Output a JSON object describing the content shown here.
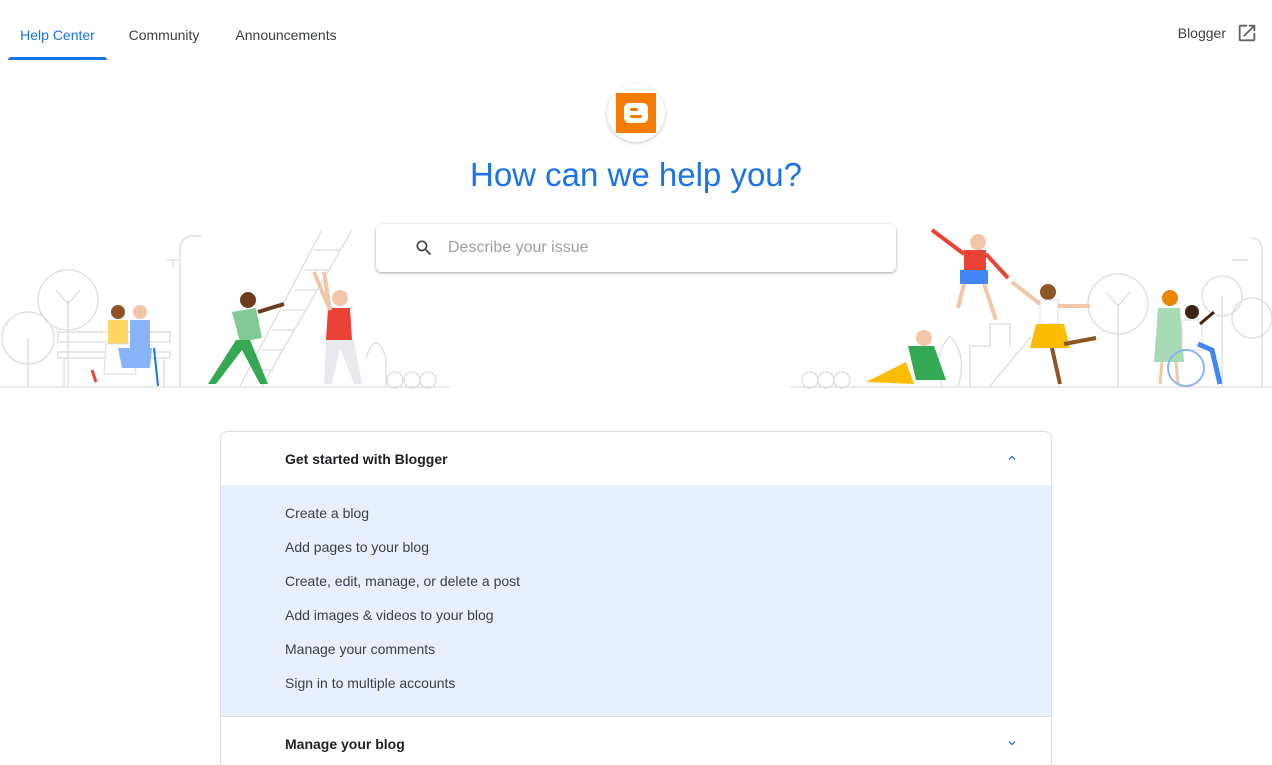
{
  "nav": {
    "tabs": [
      {
        "label": "Help Center",
        "active": true
      },
      {
        "label": "Community",
        "active": false
      },
      {
        "label": "Announcements",
        "active": false
      }
    ],
    "product_link": {
      "label": "Blogger",
      "icon": "open-in-new-icon"
    }
  },
  "hero": {
    "logo": "blogger-logo",
    "title": "How can we help you?"
  },
  "search": {
    "placeholder": "Describe your issue",
    "icon": "search-icon"
  },
  "accordion": {
    "sections": [
      {
        "title": "Get started with Blogger",
        "expanded": true,
        "links": [
          "Create a blog",
          "Add pages to your blog",
          "Create, edit, manage, or delete a post",
          "Add images & videos to your blog",
          "Manage your comments",
          "Sign in to multiple accounts"
        ]
      },
      {
        "title": "Manage your blog",
        "expanded": false,
        "links": []
      }
    ]
  },
  "colors": {
    "accent": "#1a73e8",
    "brand": "#f57c00",
    "expanded_bg": "#e8f0fe"
  }
}
